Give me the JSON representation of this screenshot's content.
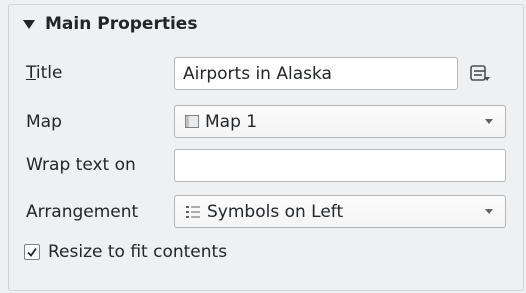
{
  "group": {
    "title": "Main Properties",
    "collapse_icon": "triangle-down-icon"
  },
  "title_row": {
    "label_first": "T",
    "label_rest": "itle",
    "value": "Airports in Alaska",
    "expression_icon": "data-defined-override-icon"
  },
  "map_row": {
    "label": "Map",
    "value": "Map 1",
    "icon": "map-item-icon"
  },
  "wrap_row": {
    "label": "Wrap text on",
    "value": ""
  },
  "arrangement_row": {
    "label": "Arrangement",
    "value": "Symbols on Left",
    "icon": "symbols-left-icon"
  },
  "resize_checkbox": {
    "label": "Resize to fit contents",
    "checked": true
  }
}
